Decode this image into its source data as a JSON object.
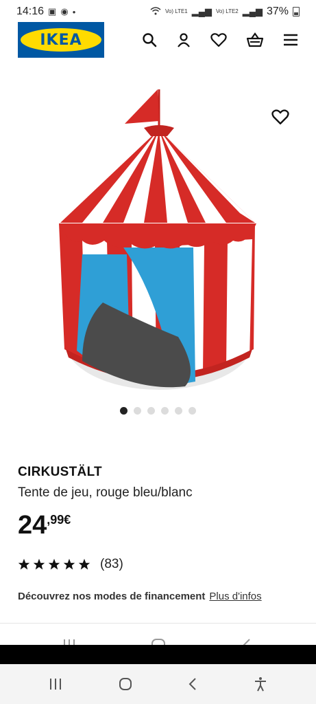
{
  "status_bar": {
    "time": "14:16",
    "signal1": "Vo) LTE1",
    "signal2": "Vo) LTE2",
    "battery": "37%"
  },
  "header": {
    "logo_text": "IKEA",
    "icons": [
      "search-icon",
      "user-icon",
      "heart-icon",
      "basket-icon",
      "menu-icon"
    ]
  },
  "gallery": {
    "image_alt": "tent-image",
    "dots_total": 6,
    "active_index": 0
  },
  "product": {
    "name": "CIRKUSTÄLT",
    "description": "Tente de jeu, rouge bleu/blanc",
    "price_int": "24",
    "price_dec": ",99€",
    "rating_stars": 5,
    "rating_count": "(83)"
  },
  "financing": {
    "text": "Découvrez nos modes de financement",
    "link": "Plus d'infos"
  },
  "colors": {
    "ikea_blue": "#0058a3",
    "ikea_yellow": "#ffdb00",
    "tent_red": "#d62b27",
    "tent_blue": "#2f9fd6"
  }
}
